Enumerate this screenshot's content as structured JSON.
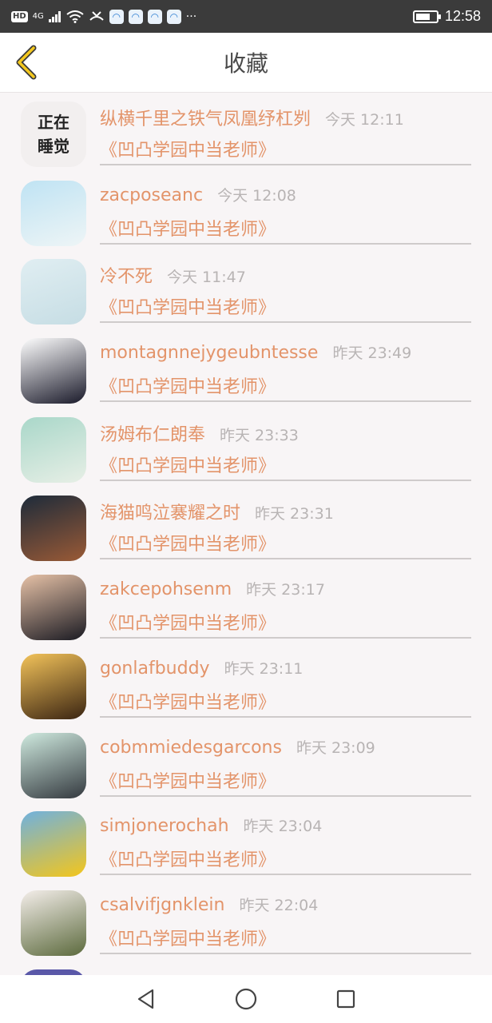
{
  "statusbar": {
    "hd": "HD",
    "signal": "4G",
    "more": "···",
    "time": "12:58",
    "battery_level": 0.7
  },
  "header": {
    "title": "收藏"
  },
  "items": [
    {
      "name": "纵横千里之铁气凤凰纾杠刿",
      "time": "今天 12:11",
      "sub": "《凹凸学园中当老师》",
      "avatar_text": [
        "正在",
        "睡觉"
      ],
      "colors": [
        "#f2efef",
        "#f2efef"
      ]
    },
    {
      "name": "zacposeanc",
      "time": "今天 12:08",
      "sub": "《凹凸学园中当老师》",
      "colors": [
        "#bfe3f3",
        "#eef5f6"
      ]
    },
    {
      "name": "冷不死",
      "time": "今天 11:47",
      "sub": "《凹凸学园中当老师》",
      "colors": [
        "#e0eef2",
        "#c6dde4"
      ]
    },
    {
      "name": "montagnnejygeubntesse",
      "time": "昨天 23:49",
      "sub": "《凹凸学园中当老师》",
      "colors": [
        "#ffffff",
        "#1a1a2a"
      ]
    },
    {
      "name": "汤姆布仁朗奉",
      "time": "昨天 23:33",
      "sub": "《凹凸学园中当老师》",
      "colors": [
        "#a9d7c9",
        "#e7efe6"
      ]
    },
    {
      "name": "海猫鸣泣褰耀之时",
      "time": "昨天 23:31",
      "sub": "《凹凸学园中当老师》",
      "colors": [
        "#1d2b3a",
        "#9a5a36"
      ]
    },
    {
      "name": "zakcepohsenm",
      "time": "昨天 23:17",
      "sub": "《凹凸学园中当老师》",
      "colors": [
        "#e7c2a7",
        "#1a1a22"
      ]
    },
    {
      "name": "gonlafbuddy",
      "time": "昨天 23:11",
      "sub": "《凹凸学园中当老师》",
      "colors": [
        "#f3c35a",
        "#3a2412"
      ]
    },
    {
      "name": "cobmmiedesgarcons",
      "time": "昨天 23:09",
      "sub": "《凹凸学园中当老师》",
      "colors": [
        "#cfeadf",
        "#34393f"
      ]
    },
    {
      "name": "simjonerochah",
      "time": "昨天 23:04",
      "sub": "《凹凸学园中当老师》",
      "colors": [
        "#6fb1df",
        "#f4c61b"
      ]
    },
    {
      "name": "csalvifjgnklein",
      "time": "昨天 22:04",
      "sub": "《凹凸学园中当老师》",
      "colors": [
        "#f4eeea",
        "#5c6a3d"
      ]
    },
    {
      "name": "",
      "time": "",
      "sub": "",
      "colors": [
        "#5a58a8",
        "#5a58a8"
      ]
    }
  ]
}
